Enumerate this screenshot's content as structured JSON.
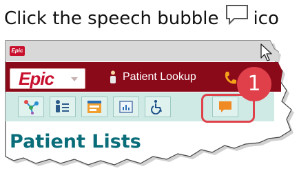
{
  "instruction": {
    "text": "Click the speech bubble",
    "trailing": "ico"
  },
  "window": {
    "logo_text": "Epic"
  },
  "epic_bar": {
    "logo_text": "Epic",
    "patient_lookup_label": "Patient Lookup"
  },
  "callout": {
    "number": "1"
  },
  "heading": {
    "text": "Patient Lists"
  },
  "colors": {
    "epic_red": "#c8102e",
    "epic_bar_bg": "#8b0a1a",
    "toolbar_bg": "#cfe9e4",
    "highlight_red": "#e0404a",
    "heading_teal": "#0a6d7a",
    "chat_orange": "#f08a24"
  },
  "icons": {
    "instruction_icon": "speech-bubble-outline",
    "toolbar": [
      "network-icon",
      "patient-list-icon",
      "schedule-icon",
      "dashboard-icon",
      "accessibility-icon",
      "speech-bubble-icon"
    ]
  }
}
